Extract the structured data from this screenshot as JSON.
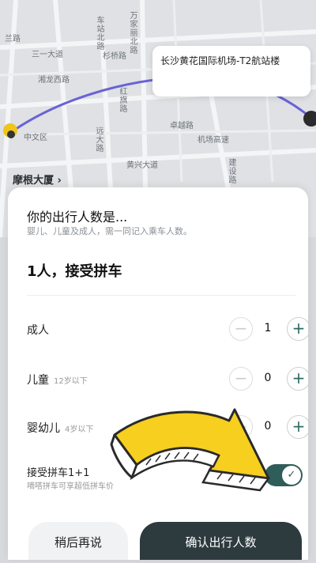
{
  "map": {
    "callout": "长沙黄花国际机场-T2航站楼",
    "landmark": "摩根大厦",
    "streets": [
      "兰路",
      "三一大道",
      "车站北路",
      "万家丽北路",
      "杉桥路",
      "湘龙西路",
      "红旗路",
      "远大路",
      "中文区",
      "卓越路",
      "机场高速",
      "黄兴大道",
      "建设路"
    ],
    "route_color": "#6a62d6"
  },
  "sheet": {
    "title": "你的出行人数是...",
    "subtitle": "婴儿、儿童及成人，需一同记入乘车人数。",
    "summary": "1人，接受拼车",
    "rows": [
      {
        "label": "成人",
        "hint": "",
        "count": "1"
      },
      {
        "label": "儿童",
        "hint": "12岁以下",
        "count": "0"
      },
      {
        "label": "婴幼儿",
        "hint": "4岁以下",
        "count": "0"
      }
    ],
    "carpool": {
      "title": "接受拼车1+1",
      "subtitle": "嘀嗒拼车可享超低拼车价",
      "enabled": true
    },
    "buttons": {
      "later": "稍后再说",
      "confirm": "确认出行人数"
    },
    "minus_symbol": "−",
    "plus_symbol": "+",
    "check_symbol": "✓"
  },
  "colors": {
    "accent": "#2f5d5a",
    "confirm_bg": "#2d3a3e",
    "arrow": "#f6cf1f"
  }
}
